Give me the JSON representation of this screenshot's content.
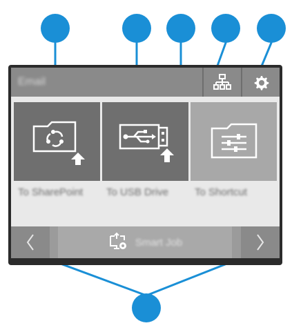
{
  "window": {
    "title": "Email"
  },
  "tiles": [
    {
      "label": "To SharePoint",
      "icon": "sharepoint-folder-icon"
    },
    {
      "label": "To USB Drive",
      "icon": "usb-drive-icon"
    },
    {
      "label": "To Shortcut",
      "icon": "shortcut-folder-icon"
    }
  ],
  "topbar": {
    "network_icon": "network-icon",
    "settings_icon": "gear-icon"
  },
  "bottombar": {
    "center_label": "Smart Job",
    "center_icon": "scan-settings-icon"
  },
  "colors": {
    "callout": "#1a8fd6",
    "frame": "#2b2b2b",
    "bar": "#8a8a8a",
    "tile_dark": "#6f6f6f",
    "tile_light": "#a8a8a8"
  }
}
